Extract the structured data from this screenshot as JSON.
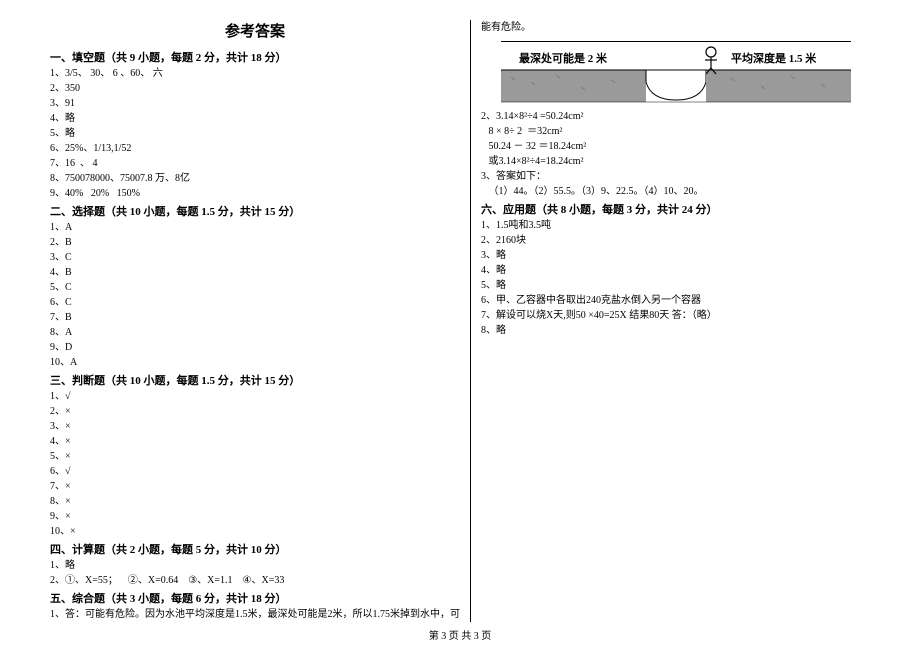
{
  "title": "参考答案",
  "footer": "第 3 页 共 3 页",
  "left": {
    "section1": {
      "header": "一、填空题（共 9 小题，每题 2 分，共计 18 分）",
      "items": [
        "1、3/5、 30、 6 、60、 六",
        "2、350",
        "3、91",
        "4、略",
        "5、略",
        "6、25%、1/13,1/52",
        "7、16  、 4",
        "8、750078000、75007.8 万、8亿",
        "9、40%   20%   150%"
      ]
    },
    "section2": {
      "header": "二、选择题（共 10 小题，每题 1.5 分，共计 15 分）",
      "items": [
        "1、A",
        "2、B",
        "3、C",
        "4、B",
        "5、C",
        "6、C",
        "7、B",
        "8、A",
        "9、D",
        "10、A"
      ]
    },
    "section3": {
      "header": "三、判断题（共 10 小题，每题 1.5 分，共计 15 分）",
      "items": [
        "1、√",
        "2、×",
        "3、×",
        "4、×",
        "5、×",
        "6、√",
        "7、×",
        "8、×",
        "9、×",
        "10、×"
      ]
    },
    "section4": {
      "header": "四、计算题（共 2 小题，每题 5 分，共计 10 分）",
      "items": [
        "1、略",
        "2、①、X=55；    ②、X=0.64    ③、X=1.1    ④、X=33"
      ]
    },
    "section5": {
      "header": "五、综合题（共 3 小题，每题 6 分，共计 18 分）",
      "items": [
        "1、答：可能有危险。因为水池平均深度是1.5米，最深处可能是2米，所以1.75米掉到水中，可"
      ]
    }
  },
  "right": {
    "continuation": "能有危险。",
    "image": {
      "label_left": "最深处可能是 2 米",
      "label_right": "平均深度是 1.5 米"
    },
    "sec5_items": [
      "2、3.14×8²÷4 =50.24cm²",
      "   8 × 8÷ 2  ＝32cm²",
      "   50.24 － 32 ＝18.24cm²",
      "   或3.14×8²÷4=18.24cm²",
      "3、答案如下：",
      "   （1）44。（2）55.5。（3）9、22.5。（4）10、20。"
    ],
    "section6": {
      "header": "六、应用题（共 8 小题，每题 3 分，共计 24 分）",
      "items": [
        "1、1.5吨和3.5吨",
        "2、2160块",
        "3、略",
        "4、略",
        "5、略",
        "6、甲、乙容器中各取出240克盐水倒入另一个容器",
        "7、解设可以烧X天,则50 ×40=25X 结果80天 答：（略）",
        "8、略"
      ]
    }
  }
}
